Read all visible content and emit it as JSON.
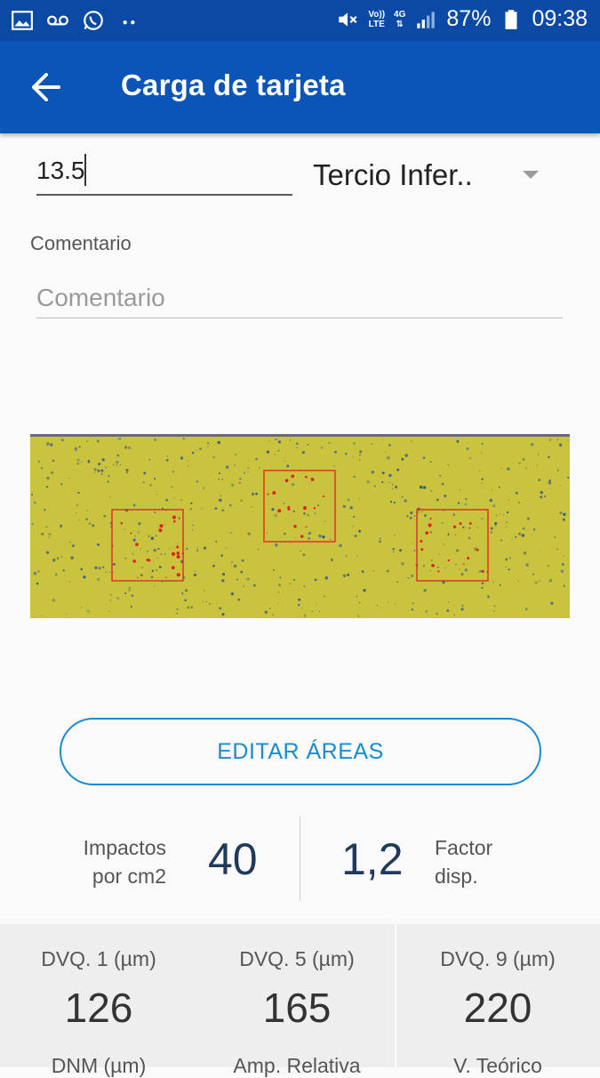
{
  "status_bar": {
    "battery": "87%",
    "time": "09:38",
    "volte_line1": "Vo))",
    "volte_line2": "LTE",
    "network": "4G"
  },
  "app_bar": {
    "title": "Carga de tarjeta"
  },
  "form": {
    "value": "13.5",
    "position_select": "Tercio Infer..",
    "comment_label": "Comentario",
    "comment_placeholder": "Comentario"
  },
  "edit_button": "EDITAR ÁREAS",
  "metrics": {
    "impacts_label_1": "Impactos",
    "impacts_label_2": "por cm2",
    "impacts_value": "40",
    "factor_value": "1,2",
    "factor_label_1": "Factor",
    "factor_label_2": "disp."
  },
  "stats": {
    "dvq1_label": "DVQ. 1 (µm)",
    "dvq1_value": "126",
    "dvq5_label": "DVQ. 5 (µm)",
    "dvq5_value": "165",
    "dvq9_label": "DVQ. 9 (µm)",
    "dvq9_value": "220",
    "dnm_label": "DNM (µm)",
    "amp_label": "Amp. Relativa",
    "vt_label": "V. Teórico"
  },
  "colors": {
    "status_bar": "#0a4aa6",
    "app_bar": "#0a55b7",
    "accent": "#1a8bd0",
    "card_yellow": "#c9c33d",
    "roi_red": "#e02020"
  }
}
